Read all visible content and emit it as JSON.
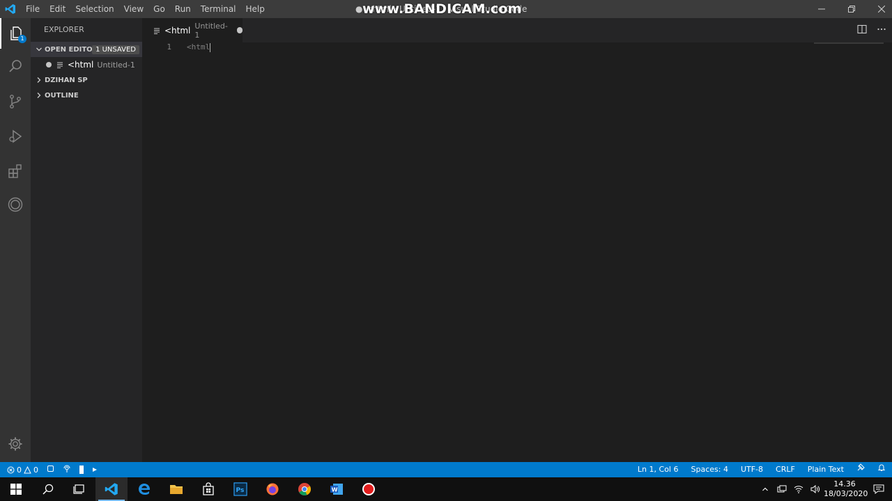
{
  "titlebar": {
    "menu": [
      "File",
      "Edit",
      "Selection",
      "View",
      "Go",
      "Run",
      "Terminal",
      "Help"
    ],
    "window_title": "● <html · Untitled-1 · Visual Studio Code",
    "watermark": "www.BANDICAM.com"
  },
  "activity": {
    "explorer_badge": "1"
  },
  "sidebar": {
    "title": "EXPLORER",
    "open_editors": {
      "label": "OPEN EDITO...",
      "badge": "1 UNSAVED",
      "files": [
        {
          "name": "<html",
          "path": "Untitled-1"
        }
      ]
    },
    "folder": {
      "label": "DZIHAN SP"
    },
    "outline": {
      "label": "OUTLINE"
    }
  },
  "tabs": [
    {
      "name": "<html",
      "path": "Untitled-1"
    }
  ],
  "editor": {
    "lines": [
      {
        "num": "1",
        "text": "<html"
      }
    ]
  },
  "statusbar": {
    "errors": "0",
    "warnings": "0",
    "position": "Ln 1, Col 6",
    "spaces": "Spaces: 4",
    "encoding": "UTF-8",
    "eol": "CRLF",
    "language": "Plain Text"
  },
  "taskbar": {
    "time": "14.36",
    "date": "18/03/2020"
  },
  "colors": {
    "accent": "#007acc",
    "titlebar": "#3c3c3c",
    "activitybar": "#333333",
    "sidebar": "#252526",
    "editor": "#1e1e1e"
  }
}
